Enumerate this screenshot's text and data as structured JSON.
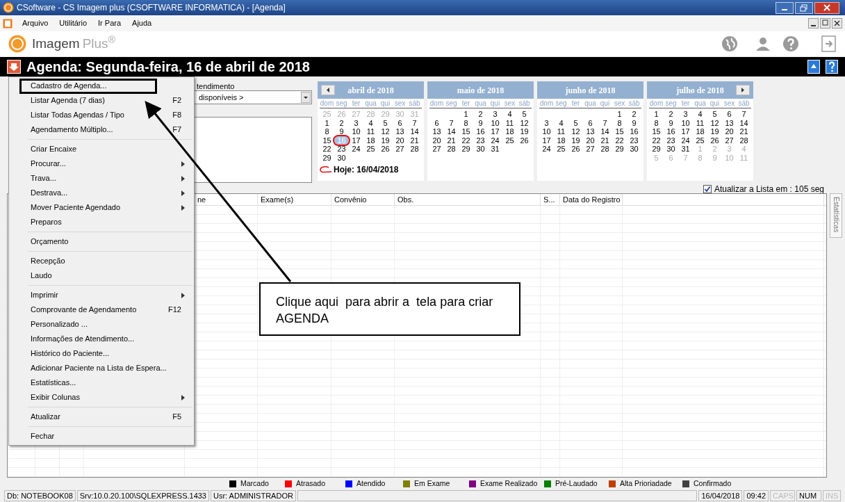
{
  "window": {
    "title": "CSoftware - CS Imagem plus (CSOFTWARE INFORMATICA) - [Agenda]"
  },
  "menu_bar": [
    "Arquivo",
    "Utilitário",
    "Ir Para",
    "Ajuda"
  ],
  "logo": {
    "name": "Imagem",
    "suffix": "Plus$^{®}$"
  },
  "header": {
    "title": "Agenda: Segunda-feira, 16 de abril de 2018"
  },
  "filter": {
    "label": "tendimento",
    "combo_value": "disponíveis >"
  },
  "calendars": [
    {
      "title": "abril de 2018",
      "prev_button": true,
      "next_button": false,
      "weekdays": [
        "dom",
        "seg",
        "ter",
        "qua",
        "qui",
        "sex",
        "sáb"
      ],
      "days": [
        {
          "kind": "muted",
          "t": "25"
        },
        {
          "kind": "muted",
          "t": "26"
        },
        {
          "kind": "muted",
          "t": "27"
        },
        {
          "kind": "muted",
          "t": "28"
        },
        {
          "kind": "muted",
          "t": "29"
        },
        {
          "kind": "muted",
          "t": "30"
        },
        {
          "kind": "muted",
          "t": "31"
        },
        {
          "kind": "day",
          "t": "1",
          "selected": false
        },
        {
          "kind": "day",
          "t": "2",
          "selected": false
        },
        {
          "kind": "day",
          "t": "3",
          "selected": false
        },
        {
          "kind": "day",
          "t": "4",
          "selected": false
        },
        {
          "kind": "day",
          "t": "5",
          "selected": false
        },
        {
          "kind": "day",
          "t": "6",
          "selected": false
        },
        {
          "kind": "day",
          "t": "7",
          "selected": false
        },
        {
          "kind": "day",
          "t": "8",
          "selected": false
        },
        {
          "kind": "day",
          "t": "9",
          "selected": false
        },
        {
          "kind": "day",
          "t": "10",
          "selected": false
        },
        {
          "kind": "day",
          "t": "11",
          "selected": false
        },
        {
          "kind": "day",
          "t": "12",
          "selected": false
        },
        {
          "kind": "day",
          "t": "13",
          "selected": false
        },
        {
          "kind": "day",
          "t": "14",
          "selected": false
        },
        {
          "kind": "day",
          "t": "15",
          "selected": false
        },
        {
          "kind": "day",
          "t": "16",
          "selected": true
        },
        {
          "kind": "day",
          "t": "17",
          "selected": false
        },
        {
          "kind": "day",
          "t": "18",
          "selected": false
        },
        {
          "kind": "day",
          "t": "19",
          "selected": false
        },
        {
          "kind": "day",
          "t": "20",
          "selected": false
        },
        {
          "kind": "day",
          "t": "21",
          "selected": false
        },
        {
          "kind": "day",
          "t": "22",
          "selected": false
        },
        {
          "kind": "day",
          "t": "23",
          "selected": false
        },
        {
          "kind": "day",
          "t": "24",
          "selected": false
        },
        {
          "kind": "day",
          "t": "25",
          "selected": false
        },
        {
          "kind": "day",
          "t": "26",
          "selected": false
        },
        {
          "kind": "day",
          "t": "27",
          "selected": false
        },
        {
          "kind": "day",
          "t": "28",
          "selected": false
        },
        {
          "kind": "day",
          "t": "29",
          "selected": false
        },
        {
          "kind": "day",
          "t": "30",
          "selected": false
        }
      ],
      "today": "Hoje: 16/04/2018"
    },
    {
      "title": "maio de 2018",
      "prev_button": false,
      "next_button": false,
      "weekdays": [
        "dom",
        "seg",
        "ter",
        "qua",
        "qui",
        "sex",
        "sáb"
      ],
      "days": [
        {
          "kind": "blank"
        },
        {
          "kind": "blank"
        },
        {
          "kind": "day",
          "t": "1",
          "selected": false
        },
        {
          "kind": "day",
          "t": "2",
          "selected": false
        },
        {
          "kind": "day",
          "t": "3",
          "selected": false
        },
        {
          "kind": "day",
          "t": "4",
          "selected": false
        },
        {
          "kind": "day",
          "t": "5",
          "selected": false
        },
        {
          "kind": "day",
          "t": "6",
          "selected": false
        },
        {
          "kind": "day",
          "t": "7",
          "selected": false
        },
        {
          "kind": "day",
          "t": "8",
          "selected": false
        },
        {
          "kind": "day",
          "t": "9",
          "selected": false
        },
        {
          "kind": "day",
          "t": "10",
          "selected": false
        },
        {
          "kind": "day",
          "t": "11",
          "selected": false
        },
        {
          "kind": "day",
          "t": "12",
          "selected": false
        },
        {
          "kind": "day",
          "t": "13",
          "selected": false
        },
        {
          "kind": "day",
          "t": "14",
          "selected": false
        },
        {
          "kind": "day",
          "t": "15",
          "selected": false
        },
        {
          "kind": "day",
          "t": "16",
          "selected": false
        },
        {
          "kind": "day",
          "t": "17",
          "selected": false
        },
        {
          "kind": "day",
          "t": "18",
          "selected": false
        },
        {
          "kind": "day",
          "t": "19",
          "selected": false
        },
        {
          "kind": "day",
          "t": "20",
          "selected": false
        },
        {
          "kind": "day",
          "t": "21",
          "selected": false
        },
        {
          "kind": "day",
          "t": "22",
          "selected": false
        },
        {
          "kind": "day",
          "t": "23",
          "selected": false
        },
        {
          "kind": "day",
          "t": "24",
          "selected": false
        },
        {
          "kind": "day",
          "t": "25",
          "selected": false
        },
        {
          "kind": "day",
          "t": "26",
          "selected": false
        },
        {
          "kind": "day",
          "t": "27",
          "selected": false
        },
        {
          "kind": "day",
          "t": "28",
          "selected": false
        },
        {
          "kind": "day",
          "t": "29",
          "selected": false
        },
        {
          "kind": "day",
          "t": "30",
          "selected": false
        },
        {
          "kind": "day",
          "t": "31",
          "selected": false
        }
      ]
    },
    {
      "title": "junho de 2018",
      "prev_button": false,
      "next_button": false,
      "weekdays": [
        "dom",
        "seg",
        "ter",
        "qua",
        "qui",
        "sex",
        "sáb"
      ],
      "days": [
        {
          "kind": "blank"
        },
        {
          "kind": "blank"
        },
        {
          "kind": "blank"
        },
        {
          "kind": "blank"
        },
        {
          "kind": "blank"
        },
        {
          "kind": "day",
          "t": "1",
          "selected": false
        },
        {
          "kind": "day",
          "t": "2",
          "selected": false
        },
        {
          "kind": "day",
          "t": "3",
          "selected": false
        },
        {
          "kind": "day",
          "t": "4",
          "selected": false
        },
        {
          "kind": "day",
          "t": "5",
          "selected": false
        },
        {
          "kind": "day",
          "t": "6",
          "selected": false
        },
        {
          "kind": "day",
          "t": "7",
          "selected": false
        },
        {
          "kind": "day",
          "t": "8",
          "selected": false
        },
        {
          "kind": "day",
          "t": "9",
          "selected": false
        },
        {
          "kind": "day",
          "t": "10",
          "selected": false
        },
        {
          "kind": "day",
          "t": "11",
          "selected": false
        },
        {
          "kind": "day",
          "t": "12",
          "selected": false
        },
        {
          "kind": "day",
          "t": "13",
          "selected": false
        },
        {
          "kind": "day",
          "t": "14",
          "selected": false
        },
        {
          "kind": "day",
          "t": "15",
          "selected": false
        },
        {
          "kind": "day",
          "t": "16",
          "selected": false
        },
        {
          "kind": "day",
          "t": "17",
          "selected": false
        },
        {
          "kind": "day",
          "t": "18",
          "selected": false
        },
        {
          "kind": "day",
          "t": "19",
          "selected": false
        },
        {
          "kind": "day",
          "t": "20",
          "selected": false
        },
        {
          "kind": "day",
          "t": "21",
          "selected": false
        },
        {
          "kind": "day",
          "t": "22",
          "selected": false
        },
        {
          "kind": "day",
          "t": "23",
          "selected": false
        },
        {
          "kind": "day",
          "t": "24",
          "selected": false
        },
        {
          "kind": "day",
          "t": "25",
          "selected": false
        },
        {
          "kind": "day",
          "t": "26",
          "selected": false
        },
        {
          "kind": "day",
          "t": "27",
          "selected": false
        },
        {
          "kind": "day",
          "t": "28",
          "selected": false
        },
        {
          "kind": "day",
          "t": "29",
          "selected": false
        },
        {
          "kind": "day",
          "t": "30",
          "selected": false
        }
      ]
    },
    {
      "title": "julho de 2018",
      "prev_button": false,
      "next_button": true,
      "weekdays": [
        "dom",
        "seg",
        "ter",
        "qua",
        "qui",
        "sex",
        "sáb"
      ],
      "days": [
        {
          "kind": "day",
          "t": "1",
          "selected": false
        },
        {
          "kind": "day",
          "t": "2",
          "selected": false
        },
        {
          "kind": "day",
          "t": "3",
          "selected": false
        },
        {
          "kind": "day",
          "t": "4",
          "selected": false
        },
        {
          "kind": "day",
          "t": "5",
          "selected": false
        },
        {
          "kind": "day",
          "t": "6",
          "selected": false
        },
        {
          "kind": "day",
          "t": "7",
          "selected": false
        },
        {
          "kind": "day",
          "t": "8",
          "selected": false
        },
        {
          "kind": "day",
          "t": "9",
          "selected": false
        },
        {
          "kind": "day",
          "t": "10",
          "selected": false
        },
        {
          "kind": "day",
          "t": "11",
          "selected": false
        },
        {
          "kind": "day",
          "t": "12",
          "selected": false
        },
        {
          "kind": "day",
          "t": "13",
          "selected": false
        },
        {
          "kind": "day",
          "t": "14",
          "selected": false
        },
        {
          "kind": "day",
          "t": "15",
          "selected": false
        },
        {
          "kind": "day",
          "t": "16",
          "selected": false
        },
        {
          "kind": "day",
          "t": "17",
          "selected": false
        },
        {
          "kind": "day",
          "t": "18",
          "selected": false
        },
        {
          "kind": "day",
          "t": "19",
          "selected": false
        },
        {
          "kind": "day",
          "t": "20",
          "selected": false
        },
        {
          "kind": "day",
          "t": "21",
          "selected": false
        },
        {
          "kind": "day",
          "t": "22",
          "selected": false
        },
        {
          "kind": "day",
          "t": "23",
          "selected": false
        },
        {
          "kind": "day",
          "t": "24",
          "selected": false
        },
        {
          "kind": "day",
          "t": "25",
          "selected": false
        },
        {
          "kind": "day",
          "t": "26",
          "selected": false
        },
        {
          "kind": "day",
          "t": "27",
          "selected": false
        },
        {
          "kind": "day",
          "t": "28",
          "selected": false
        },
        {
          "kind": "day",
          "t": "29",
          "selected": false
        },
        {
          "kind": "day",
          "t": "30",
          "selected": false
        },
        {
          "kind": "day",
          "t": "31",
          "selected": false
        },
        {
          "kind": "muted",
          "t": "1"
        },
        {
          "kind": "muted",
          "t": "2"
        },
        {
          "kind": "muted",
          "t": "3"
        },
        {
          "kind": "muted",
          "t": "4"
        },
        {
          "kind": "muted",
          "t": "5"
        },
        {
          "kind": "muted",
          "t": "6"
        },
        {
          "kind": "muted",
          "t": "7"
        },
        {
          "kind": "muted",
          "t": "8"
        },
        {
          "kind": "muted",
          "t": "9"
        },
        {
          "kind": "muted",
          "t": "10"
        },
        {
          "kind": "muted",
          "t": "11"
        }
      ]
    }
  ],
  "auto_refresh": {
    "label": "Atualizar a Lista em : 105 seg",
    "checked": true
  },
  "table": {
    "columns": [
      "ne",
      "Exame(s)",
      "Convênio",
      "Obs.",
      "S...",
      "Data do Registro"
    ]
  },
  "side_tab": "Estatísticas",
  "context_menu": [
    {
      "kind": "item",
      "label": "Cadastro de Agenda...",
      "submenu": false,
      "highlighted": true
    },
    {
      "kind": "item",
      "label": "Listar Agenda (7 dias)",
      "shortcut": "F2",
      "submenu": false,
      "highlighted": false
    },
    {
      "kind": "item",
      "label": "Listar Todas Agendas / Tipo",
      "shortcut": "F8",
      "submenu": false,
      "highlighted": false
    },
    {
      "kind": "item",
      "label": "Agendamento Múltiplo...",
      "shortcut": "F7",
      "submenu": false,
      "highlighted": false
    },
    {
      "kind": "separator"
    },
    {
      "kind": "item",
      "label": "Criar Encaixe",
      "submenu": false,
      "highlighted": false
    },
    {
      "kind": "item",
      "label": "Procurar...",
      "submenu": true,
      "highlighted": false
    },
    {
      "kind": "item",
      "label": "Trava...",
      "submenu": true,
      "highlighted": false
    },
    {
      "kind": "item",
      "label": "Destrava...",
      "submenu": true,
      "highlighted": false
    },
    {
      "kind": "item",
      "label": "Mover Paciente Agendado",
      "submenu": true,
      "highlighted": false
    },
    {
      "kind": "item",
      "label": "Preparos",
      "submenu": false,
      "highlighted": false
    },
    {
      "kind": "separator"
    },
    {
      "kind": "item",
      "label": "Orçamento",
      "submenu": false,
      "highlighted": false
    },
    {
      "kind": "separator"
    },
    {
      "kind": "item",
      "label": "Recepção",
      "submenu": false,
      "highlighted": false
    },
    {
      "kind": "item",
      "label": "Laudo",
      "submenu": false,
      "highlighted": false
    },
    {
      "kind": "separator"
    },
    {
      "kind": "item",
      "label": "Imprimir",
      "submenu": true,
      "highlighted": false
    },
    {
      "kind": "item",
      "label": "Comprovante de Agendamento",
      "shortcut": "F12",
      "submenu": false,
      "highlighted": false
    },
    {
      "kind": "item",
      "label": "Personalizado ...",
      "submenu": false,
      "highlighted": false
    },
    {
      "kind": "item",
      "label": "Informações de Atendimento...",
      "submenu": false,
      "highlighted": false
    },
    {
      "kind": "item",
      "label": "Histórico do Paciente...",
      "submenu": false,
      "highlighted": false
    },
    {
      "kind": "item",
      "label": "Adicionar Paciente na Lista de Espera...",
      "submenu": false,
      "highlighted": false
    },
    {
      "kind": "item",
      "label": "Estatísticas...",
      "submenu": false,
      "highlighted": false
    },
    {
      "kind": "item",
      "label": "Exibir Colunas",
      "submenu": true,
      "highlighted": false
    },
    {
      "kind": "separator"
    },
    {
      "kind": "item",
      "label": "Atualizar",
      "shortcut": "F5",
      "submenu": false,
      "highlighted": false
    },
    {
      "kind": "separator"
    },
    {
      "kind": "item",
      "label": "Fechar",
      "submenu": false,
      "highlighted": false
    }
  ],
  "callout": {
    "text": "Clique aqui  para abrir a  tela para criar AGENDA"
  },
  "legend": [
    {
      "label": "Marcado",
      "color": "#000000"
    },
    {
      "label": "Atrasado",
      "color": "#ff0000"
    },
    {
      "label": "Atendido",
      "color": "#0000ff"
    },
    {
      "label": "Em Exame",
      "color": "#808000"
    },
    {
      "label": "Exame Realizado",
      "color": "#800080"
    },
    {
      "label": "Pré-Laudado",
      "color": "#008000"
    },
    {
      "label": "Alta Prioriadade",
      "color": "#c04000"
    },
    {
      "label": "Confirmado",
      "color": "#404040"
    }
  ],
  "status_bar": [
    {
      "text": "Db: NOTEBOOK08",
      "disabled": false
    },
    {
      "text": "Srv:10.0.20.100\\SQLEXPRESS.1433",
      "disabled": false
    },
    {
      "text": "Usr: ADMINISTRADOR",
      "disabled": false
    },
    {
      "text": "16/04/2018",
      "disabled": false
    },
    {
      "text": "09:42",
      "disabled": false
    },
    {
      "text": "CAPS",
      "disabled": true
    },
    {
      "text": "NUM",
      "disabled": false
    },
    {
      "text": "INS",
      "disabled": true
    }
  ]
}
